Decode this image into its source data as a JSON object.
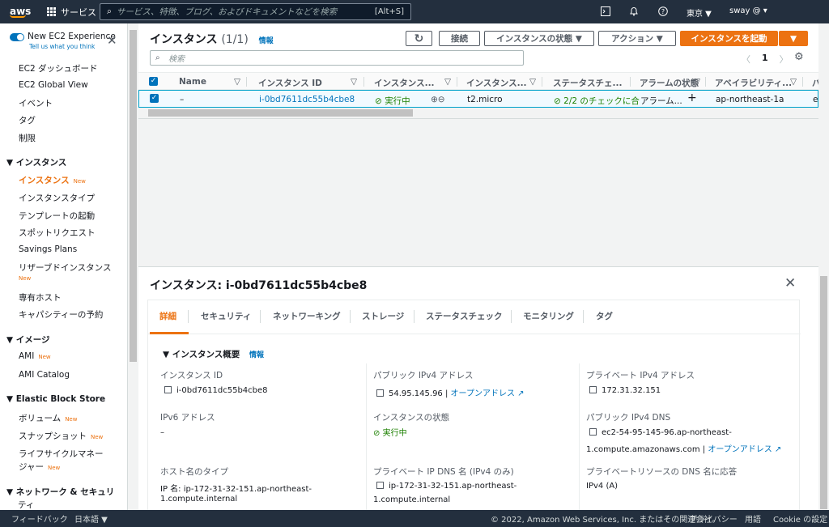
{
  "topnav": {
    "logo": "aws",
    "services": "サービス",
    "search_placeholder": "サービス、特徴、ブログ、およびドキュメントなどを検索",
    "search_shortcut": "[Alt+S]",
    "region": "東京 ▼",
    "user": "sway @ ▾",
    "icons": [
      "cloudshell-icon",
      "bell-icon",
      "help-icon"
    ]
  },
  "sidebar": {
    "new_experience": "New EC2 Experience",
    "tell_us": "Tell us what you think",
    "items": [
      {
        "label": "EC2 ダッシュボード"
      },
      {
        "label": "EC2 Global View"
      },
      {
        "label": "イベント"
      },
      {
        "label": "タグ"
      },
      {
        "label": "制限"
      }
    ],
    "sections": [
      {
        "title": "▼ インスタンス",
        "items": [
          {
            "label": "インスタンス",
            "badge": "New",
            "active": true
          },
          {
            "label": "インスタンスタイプ"
          },
          {
            "label": "テンプレートの起動"
          },
          {
            "label": "スポットリクエスト"
          },
          {
            "label": "Savings Plans"
          },
          {
            "label": "リザーブドインスタンス",
            "badge": "New"
          },
          {
            "label": "専有ホスト"
          },
          {
            "label": "キャパシティーの予約"
          }
        ]
      },
      {
        "title": "▼ イメージ",
        "items": [
          {
            "label": "AMI",
            "badge": "New"
          },
          {
            "label": "AMI Catalog"
          }
        ]
      },
      {
        "title": "▼ Elastic Block Store",
        "items": [
          {
            "label": "ボリューム",
            "badge": "New"
          },
          {
            "label": "スナップショット",
            "badge": "New"
          },
          {
            "label": "ライフサイクルマネー",
            "label2": "ジャー",
            "badge": "New"
          }
        ]
      },
      {
        "title": "▼ ネットワーク & セキュリ",
        "title2": "ティ"
      }
    ]
  },
  "list": {
    "title": "インスタンス",
    "count": "(1/1)",
    "info": "情報",
    "buttons": {
      "refresh": "↻",
      "connect": "接続",
      "state": "インスタンスの状態 ▼",
      "actions": "アクション ▼",
      "launch": "インスタンスを起動",
      "launch_dropdown": "▼"
    },
    "filter_placeholder": "検索",
    "pager": {
      "prev": "〈",
      "page": "1",
      "next": "〉"
    },
    "columns": [
      "Name",
      "インスタンス ID",
      "インスタンス...",
      "インスタンス...",
      "ステータスチェ...",
      "アラームの状態",
      "アベイラビリティ...",
      "パ"
    ],
    "row": {
      "name": "–",
      "id": "i-0bd7611dc55b4cbe8",
      "state": "実行中",
      "type": "t2.micro",
      "status": "2/2 のチェックに合",
      "alarm": "アラーム...",
      "az": "ap-northeast-1a",
      "extra": "ec"
    }
  },
  "detail": {
    "title": "インスタンス: i-0bd7611dc55b4cbe8",
    "tabs": [
      "詳細",
      "セキュリティ",
      "ネットワーキング",
      "ストレージ",
      "ステータスチェック",
      "モニタリング",
      "タグ"
    ],
    "summary": "▼ インスタンス概要",
    "info": "情報",
    "fields": {
      "instance_id_label": "インスタンス ID",
      "instance_id": "i-0bd7611dc55b4cbe8",
      "public_ip_label": "パブリック IPv4 アドレス",
      "public_ip": "54.95.145.96 |",
      "open_address": "オープンアドレス",
      "private_ip_label": "プライベート IPv4 アドレス",
      "private_ip": "172.31.32.151",
      "ipv6_label": "IPv6 アドレス",
      "ipv6": "–",
      "state_label": "インスタンスの状態",
      "state": "実行中",
      "public_dns_label": "パブリック IPv4 DNS",
      "public_dns_1": "ec2-54-95-145-96.ap-northeast-",
      "public_dns_2": "1.compute.amazonaws.com |",
      "hostname_type_label": "ホスト名のタイプ",
      "hostname_type_1": "IP 名: ip-172-31-32-151.ap-northeast-",
      "hostname_type_2": "1.compute.internal",
      "private_dns_label": "プライベート IP DNS 名 (IPv4 のみ)",
      "private_dns_1": "ip-172-31-32-151.ap-northeast-",
      "private_dns_2": "1.compute.internal",
      "private_resource_label": "プライベートリソースの DNS 名に応答",
      "private_resource": "IPv4 (A)"
    }
  },
  "footer": {
    "feedback": "フィードバック",
    "language": "日本語 ▼",
    "copyright": "© 2022, Amazon Web Services, Inc. またはその関連会社。",
    "privacy": "プライバシー",
    "terms": "用語",
    "cookies": "Cookie の設定"
  }
}
